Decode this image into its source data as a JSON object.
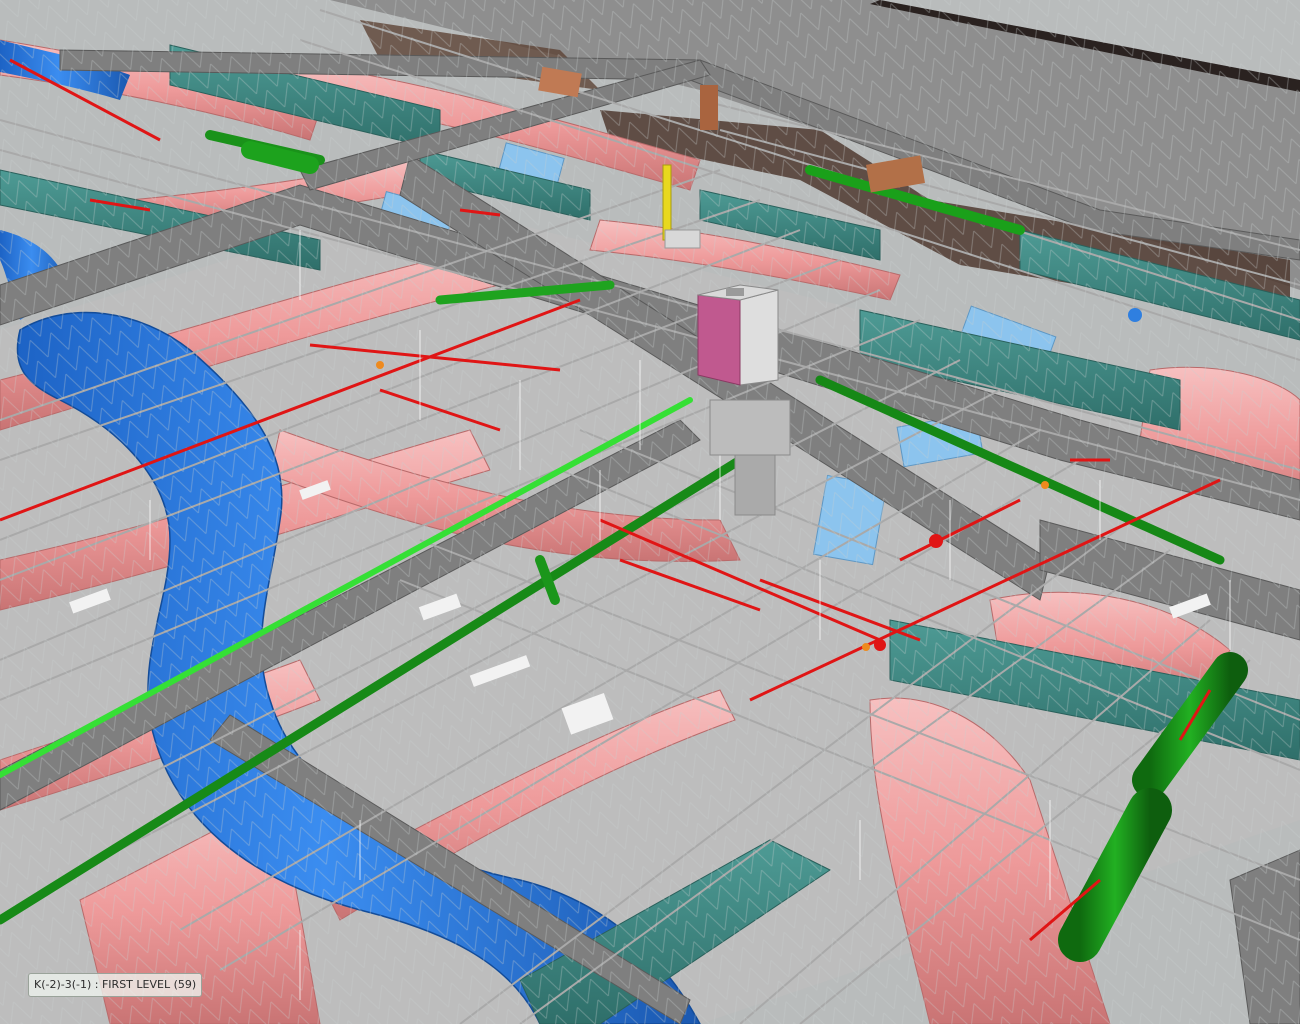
{
  "viewer": {
    "background": "#f2fff2",
    "status_label": "K(-2)-3(-1) : FIRST LEVEL (59)"
  },
  "model": {
    "colors": {
      "ceiling_slab": "#8c8c8c",
      "steel_beam": "#7f7f7f",
      "joist_truss": "#a7a7a7",
      "hvac_duct_supply": "#ef9a9a",
      "hvac_duct_return": "#2f7fe0",
      "duct_branch_light_blue": "#8cc4ee",
      "steel_plate_teal": "#3e8a84",
      "plumbing_pipe": "#1a8f1a",
      "plumbing_pipe_highlight": "#35e035",
      "fire_sprinkler_pipe": "#e01515",
      "vertical_pipe": "#e8d81e",
      "equipment_box": "#c0598f",
      "brick_wall": "#6a4a3a",
      "floor_gray": "#b8b8b8"
    }
  }
}
